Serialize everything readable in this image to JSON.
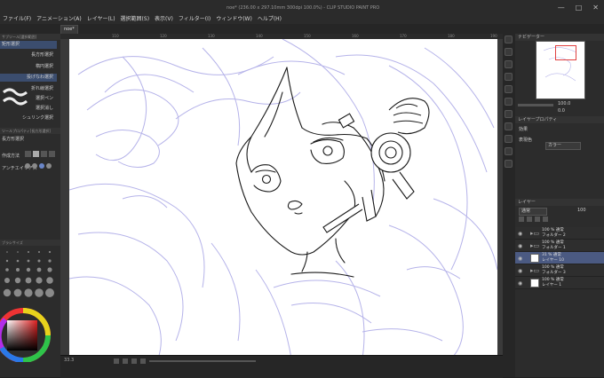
{
  "window": {
    "title": "noe* (236.00 x 297.10mm 300dpi 100.0%)  - CLIP STUDIO PAINT PRO",
    "controls": [
      "—",
      "□",
      "✕"
    ]
  },
  "menu": [
    "ファイル(F)",
    "アニメーション(A)",
    "レイヤー(L)",
    "選択範囲(S)",
    "表示(V)",
    "フィルター(I)",
    "ウィンドウ(W)",
    "ヘルプ(H)"
  ],
  "doc_tab": "noe*",
  "left_panel": {
    "header": "サブツール[選択範囲]",
    "subheader": "矩形選択",
    "subtools": [
      "長方形選択",
      "楕円選択",
      "投げなわ選択",
      "折れ線選択",
      "選択ペン",
      "選択消し",
      "シュリンク選択"
    ],
    "tool_property_header": "ツールプロパティ[長方形選択]",
    "tool_property_title": "長方形選択",
    "setting_rows": [
      "作成方法",
      "アンチエイリアス"
    ],
    "brush_size_header": "ブラシサイズ"
  },
  "ruler": {
    "ticks": [
      "110",
      "120",
      "130",
      "140",
      "150",
      "160",
      "170",
      "180",
      "190"
    ]
  },
  "status": {
    "zoom": "33.3"
  },
  "right_panel": {
    "navigator_header": "ナビゲーター",
    "zoom_value": "100.0",
    "rotate_value": "0.0",
    "layer_property_header": "レイヤープロパティ",
    "effect_label": "効果",
    "color_mode_label": "表現色",
    "color_mode_value": "カラー",
    "layer_panel_header": "レイヤー",
    "blend_mode": "通常",
    "opacity": "100",
    "layers": [
      {
        "name": "100 % 通常",
        "sub": "フォルダー 2",
        "type": "folder"
      },
      {
        "name": "100 % 通常",
        "sub": "フォルダー 1",
        "type": "folder"
      },
      {
        "name": "31 % 通常",
        "sub": "レイヤー 10",
        "type": "layer",
        "selected": true
      },
      {
        "name": "100 % 通常",
        "sub": "フォルダー 3",
        "type": "folder"
      },
      {
        "name": "100 % 通常",
        "sub": "レイヤー 1",
        "type": "layer"
      }
    ]
  },
  "colors": {
    "accent": "#4b5a82",
    "sketch_line": "#a9a6e6",
    "lineart": "#1a1a1a"
  }
}
